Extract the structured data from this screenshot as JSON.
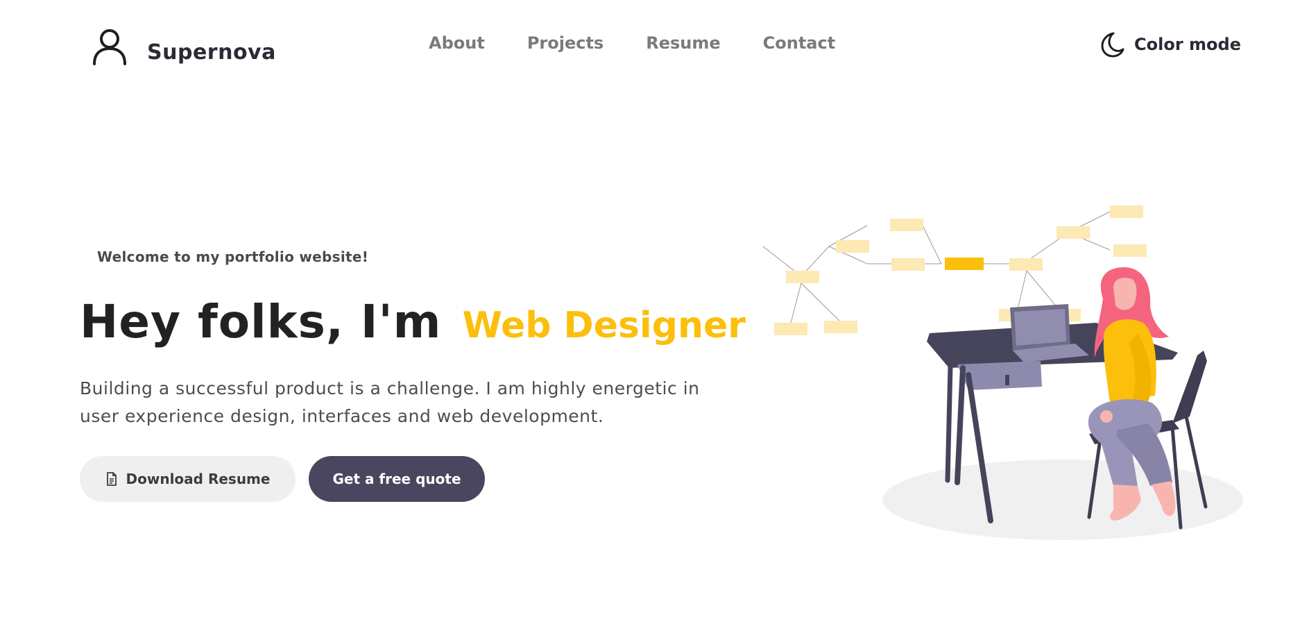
{
  "header": {
    "brand_name": "Supernova",
    "brand_icon": "user-outline-icon",
    "nav": [
      {
        "label": "About"
      },
      {
        "label": "Projects"
      },
      {
        "label": "Resume"
      },
      {
        "label": "Contact"
      }
    ],
    "color_mode_label": "Color mode",
    "color_mode_icon": "moon-icon"
  },
  "hero": {
    "welcome": "Welcome to my portfolio website!",
    "headline": "Hey folks, I'm",
    "role": "Web Designer",
    "description": "Building a successful product is a challenge. I am highly energetic in user experience design, interfaces and web development.",
    "download_button": "Download Resume",
    "download_icon": "document-icon",
    "quote_button": "Get a free quote"
  },
  "colors": {
    "accent": "#fbbf0c",
    "dark": "#4a4660",
    "text": "#222222"
  }
}
